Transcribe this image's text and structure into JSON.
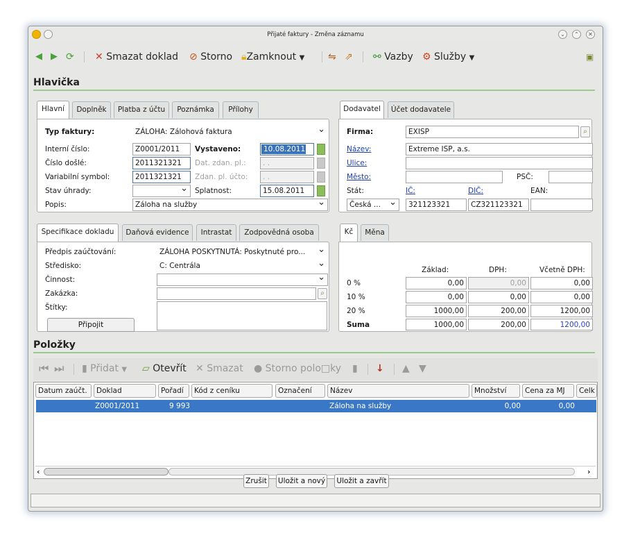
{
  "window": {
    "title": "Přijaté faktury - Změna záznamu",
    "icon_color": "#f0b400"
  },
  "toolbar": {
    "delete": "Smazat doklad",
    "storno": "Storno",
    "lock": "Zamknout",
    "links": "Vazby",
    "services": "Služby"
  },
  "header": {
    "title": "Hlavička",
    "left_tabs": [
      "Hlavní",
      "Doplněk",
      "Platba z účtu",
      "Poznámka",
      "Přílohy"
    ],
    "right_tabs": [
      "Dodavatel",
      "Účet dodavatele"
    ],
    "invoice_type": {
      "label": "Typ faktury:",
      "value": "ZÁLOHA: Zálohová faktura"
    },
    "internal_no": {
      "label": "Interní číslo:",
      "value": "Z0001/2011"
    },
    "issued": {
      "label": "Vystaveno:",
      "value": "10.08.2011"
    },
    "received_no": {
      "label": "Číslo došlé:",
      "value": "2011321321"
    },
    "tax_date": {
      "label": "Dat. zdan. pl.:",
      "value": ". ."
    },
    "var_symbol": {
      "label": "Variabilní symbol:",
      "value": "2011321321"
    },
    "tax_acc": {
      "label": "Zdan. pl. účto:",
      "value": ". ."
    },
    "pay_state": {
      "label": "Stav úhrady:",
      "value": ""
    },
    "due": {
      "label": "Splatnost:",
      "value": "15.08.2011"
    },
    "desc": {
      "label": "Popis:",
      "value": "Záloha na služby"
    },
    "supplier": {
      "firm_label": "Firma:",
      "firm": "EXISP",
      "name_label": "Název:",
      "name": "Extreme ISP, a.s.",
      "street_label": "Ulice:",
      "street": "",
      "city_label": "Město:",
      "city": "",
      "psc_label": "PSČ:",
      "psc": "",
      "state_label": "Stát:",
      "state": "Česká ...",
      "ic_label": "IČ:",
      "ic": "321123321",
      "dic_label": "DIČ:",
      "dic": "CZ321123321",
      "ean_label": "EAN:",
      "ean": ""
    }
  },
  "spec": {
    "tabs": [
      "Specifikace dokladu",
      "Daňová evidence",
      "Intrastat",
      "Zodpovědná osoba"
    ],
    "posting_label": "Předpis zaúčtování:",
    "posting": "ZÁLOHA POSKYTNUTÁ: Poskytnuté pro...",
    "center_label": "Středisko:",
    "center": "C: Centrála",
    "activity_label": "Činnost:",
    "activity": "",
    "order_label": "Zakázka:",
    "order": "",
    "tags_label": "Štítky:",
    "attach": "Připojit"
  },
  "vat": {
    "tabs": [
      "Kč",
      "Měna"
    ],
    "headers": [
      "Základ:",
      "DPH:",
      "Včetně DPH:"
    ],
    "rows": [
      {
        "rate": "0 %",
        "base": "0,00",
        "vat": "0,00",
        "total": "0,00"
      },
      {
        "rate": "10 %",
        "base": "0,00",
        "vat": "0,00",
        "total": "0,00"
      },
      {
        "rate": "20 %",
        "base": "1000,00",
        "vat": "200,00",
        "total": "1200,00"
      },
      {
        "rate": "Suma",
        "base": "1000,00",
        "vat": "200,00",
        "total": "1200,00"
      }
    ]
  },
  "items": {
    "title": "Položky",
    "toolbar": {
      "add": "Přidat",
      "open": "Otevřít",
      "delete": "Smazat",
      "storno": "Storno polo□ky"
    },
    "columns": [
      "Datum zaúčt.",
      "Doklad",
      "Pořadí",
      "Kód z ceníku",
      "Označení",
      "Název",
      "Množství",
      "Cena za MJ",
      "Celk"
    ],
    "rows": [
      {
        "date": "",
        "doc": "Z0001/2011",
        "order": "9 993",
        "code": "",
        "mark": "",
        "name": "Záloha na služby",
        "qty": "0,00",
        "price": "0,00"
      }
    ],
    "selected_color": "#3a77c6"
  },
  "footer": {
    "cancel": "Zrušit",
    "save_new": "Uložit a nový",
    "save_close": "Uložit a zavřít"
  }
}
